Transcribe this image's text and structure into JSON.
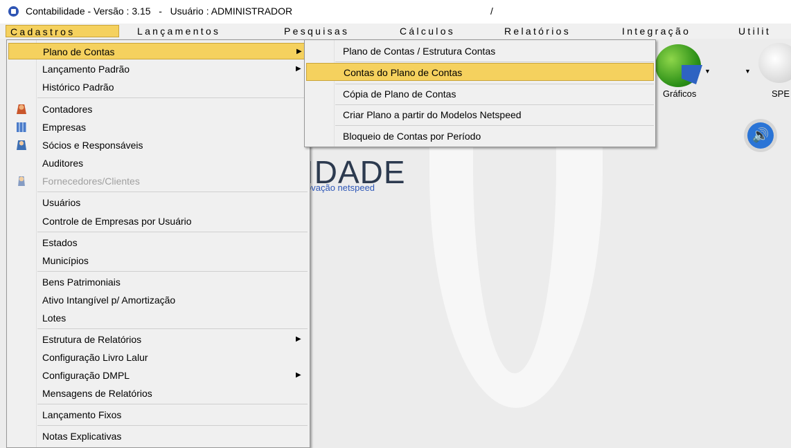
{
  "window": {
    "title": "Contabilidade - Versão : 3.15   -   Usuário : ADMINISTRADOR",
    "title_slash": "/"
  },
  "menubar": {
    "items": [
      {
        "label": "Cadastros"
      },
      {
        "label": "Lançamentos"
      },
      {
        "label": "Pesquisas"
      },
      {
        "label": "Cálculos"
      },
      {
        "label": "Relatórios"
      },
      {
        "label": "Integração"
      },
      {
        "label": "Utilit"
      }
    ]
  },
  "cadastros_menu": {
    "items": [
      {
        "label": "Plano de Contas"
      },
      {
        "label": "Lançamento Padrão"
      },
      {
        "label": "Histórico Padrão"
      },
      {
        "label": "Contadores"
      },
      {
        "label": "Empresas"
      },
      {
        "label": "Sócios e Responsáveis"
      },
      {
        "label": "Auditores"
      },
      {
        "label": "Fornecedores/Clientes"
      },
      {
        "label": "Usuários"
      },
      {
        "label": "Controle de Empresas por Usuário"
      },
      {
        "label": "Estados"
      },
      {
        "label": "Municípios"
      },
      {
        "label": "Bens Patrimoniais"
      },
      {
        "label": "Ativo Intangível p/ Amortização"
      },
      {
        "label": "Lotes"
      },
      {
        "label": "Estrutura de Relatórios"
      },
      {
        "label": "Configuração Livro Lalur"
      },
      {
        "label": "Configuração DMPL"
      },
      {
        "label": "Mensagens de Relatórios"
      },
      {
        "label": "Lançamento Fixos"
      },
      {
        "label": "Notas Explicativas"
      }
    ]
  },
  "plano_submenu": {
    "items": [
      {
        "label": "Plano de Contas / Estrutura Contas"
      },
      {
        "label": "Contas do Plano de Contas"
      },
      {
        "label": "Cópia de Plano de Contas"
      },
      {
        "label": "Criar Plano a partir do Modelos Netspeed"
      },
      {
        "label": "Bloqueio de Contas por Período"
      }
    ]
  },
  "toolbar": {
    "graficos_label": "Gráficos",
    "spe_label": "SPE"
  },
  "logo": {
    "text": "IDADE",
    "subtitle": "ovação netspeed"
  },
  "icons": {
    "app": "app-icon",
    "graficos": "pie-chart-icon",
    "spe": "spe-icon",
    "sound": "speaker-icon"
  },
  "colors": {
    "highlight": "#f5d15e",
    "highlight_border": "#c9a43a",
    "brand_blue": "#2e57b8"
  }
}
